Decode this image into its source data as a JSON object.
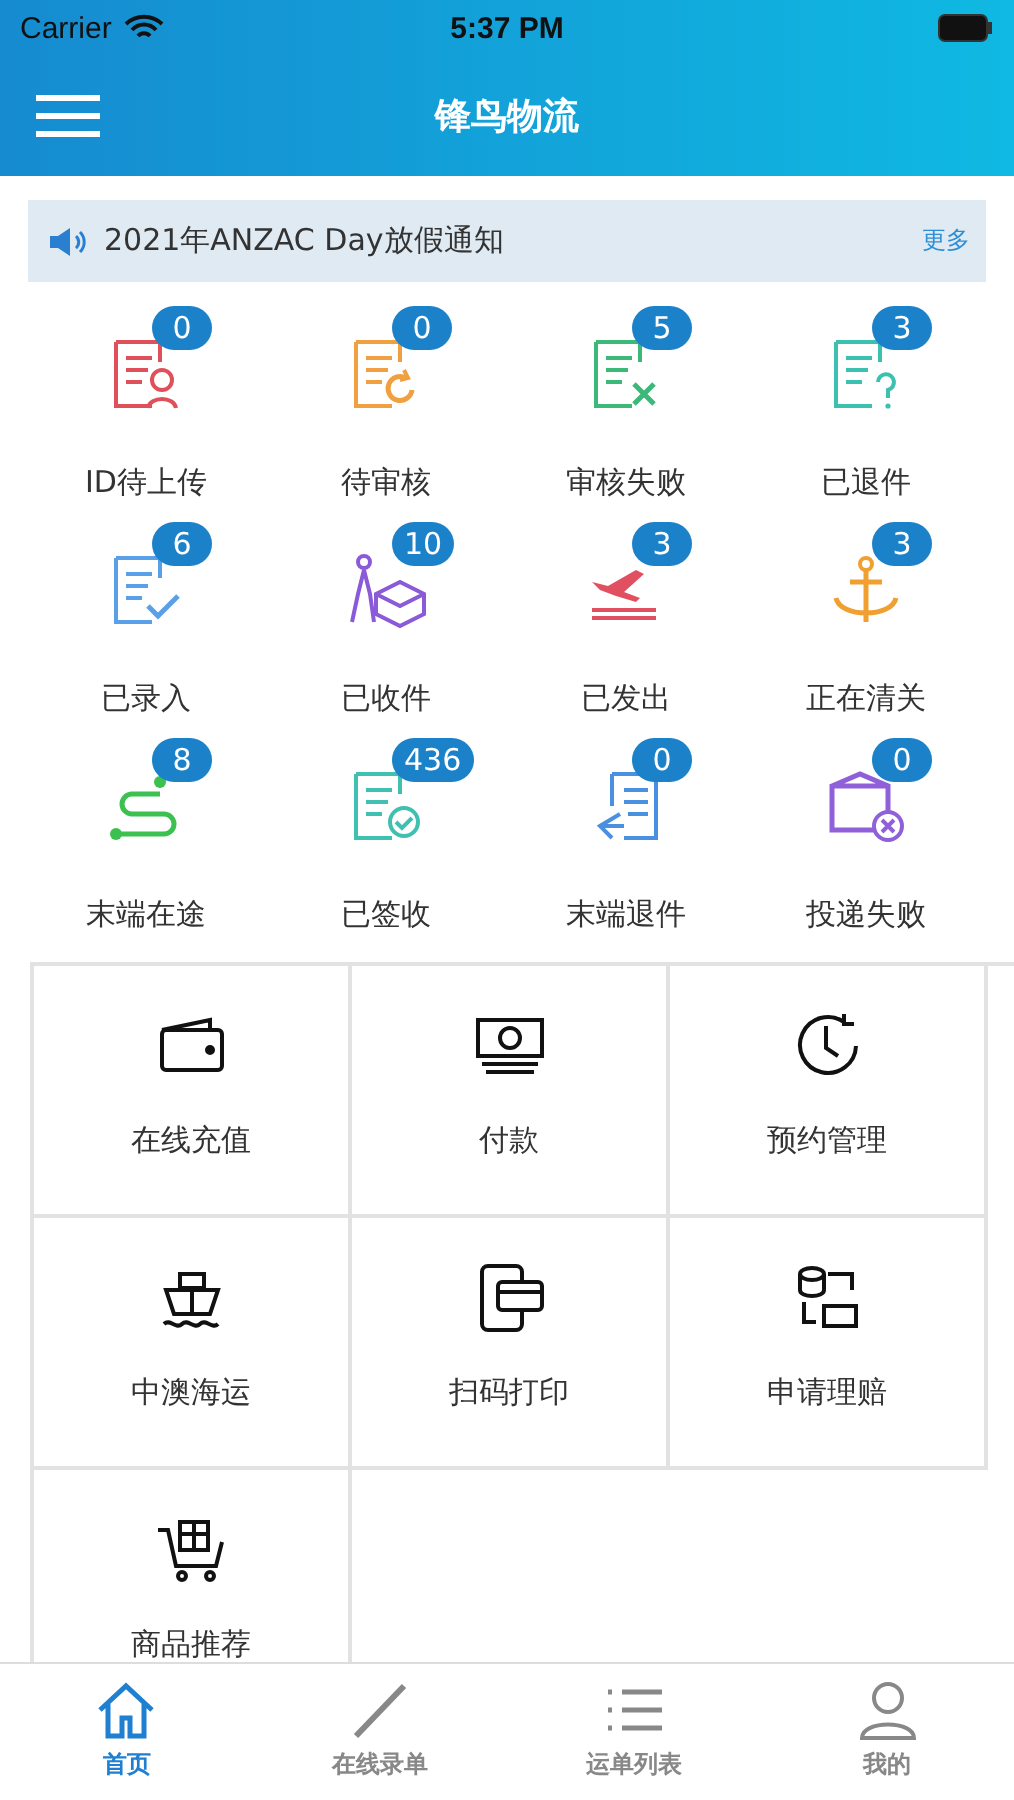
{
  "status_bar": {
    "carrier": "Carrier",
    "time": "5:37 PM"
  },
  "nav": {
    "title": "锋鸟物流"
  },
  "notice": {
    "text": "2021年ANZAC Day放假通知",
    "more": "更多"
  },
  "statuses": [
    {
      "label": "ID待上传",
      "count": "0"
    },
    {
      "label": "待审核",
      "count": "0"
    },
    {
      "label": "审核失败",
      "count": "5"
    },
    {
      "label": "已退件",
      "count": "3"
    },
    {
      "label": "已录入",
      "count": "6"
    },
    {
      "label": "已收件",
      "count": "10"
    },
    {
      "label": "已发出",
      "count": "3"
    },
    {
      "label": "正在清关",
      "count": "3"
    },
    {
      "label": "末端在途",
      "count": "8"
    },
    {
      "label": "已签收",
      "count": "436"
    },
    {
      "label": "末端退件",
      "count": "0"
    },
    {
      "label": "投递失败",
      "count": "0"
    }
  ],
  "functions": [
    {
      "label": "在线充值"
    },
    {
      "label": "付款"
    },
    {
      "label": "预约管理"
    },
    {
      "label": "中澳海运"
    },
    {
      "label": "扫码打印"
    },
    {
      "label": "申请理赔"
    },
    {
      "label": "商品推荐"
    }
  ],
  "tab_bar": [
    {
      "label": "首页",
      "selected": true
    },
    {
      "label": "在线录单",
      "selected": false
    },
    {
      "label": "运单列表",
      "selected": false
    },
    {
      "label": "我的",
      "selected": false
    }
  ]
}
